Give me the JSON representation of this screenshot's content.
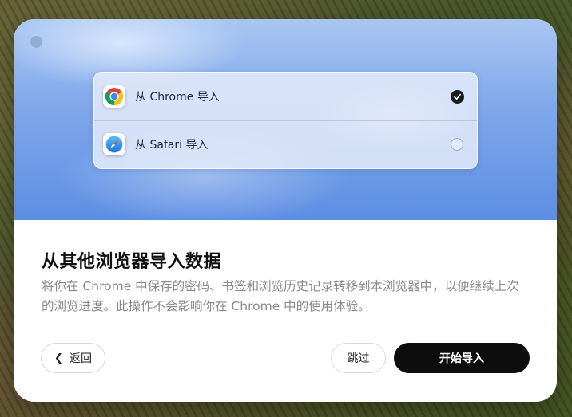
{
  "options": [
    {
      "label": "从 Chrome 导入",
      "icon": "chrome-icon",
      "selected": true
    },
    {
      "label": "从 Safari 导入",
      "icon": "safari-icon",
      "selected": false
    }
  ],
  "title": "从其他浏览器导入数据",
  "description_line1": "将你在 Chrome 中保存的密码、书签和浏览历史记录转移到本浏览器中，以便继续上次",
  "description_line2": "的浏览进度。此操作不会影响你在 Chrome 中的使用体验。",
  "buttons": {
    "back": "返回",
    "skip": "跳过",
    "start": "开始导入"
  },
  "colors": {
    "primary_button": "#0d0d0d",
    "hero_blue": "#5d8ee3"
  }
}
